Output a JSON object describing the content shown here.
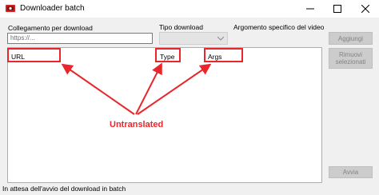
{
  "window": {
    "title": "Downloader batch",
    "controls": {
      "minimize": "minimize-icon",
      "maximize": "maximize-icon",
      "close": "close-icon"
    }
  },
  "form": {
    "url_label": "Collegamento per download",
    "url_placeholder": "https://...",
    "type_label": "Tipo download",
    "args_label": "Argomento specifico del video"
  },
  "list": {
    "columns": [
      "URL",
      "Type",
      "Args"
    ]
  },
  "buttons": {
    "add": "Aggiungi",
    "remove_line1": "Rimuovi",
    "remove_line2": "selezionati",
    "start": "Avvia"
  },
  "status": "In attesa dell'avvio del download in batch",
  "annotation": {
    "label": "Untranslated",
    "color": "#e8262b"
  }
}
